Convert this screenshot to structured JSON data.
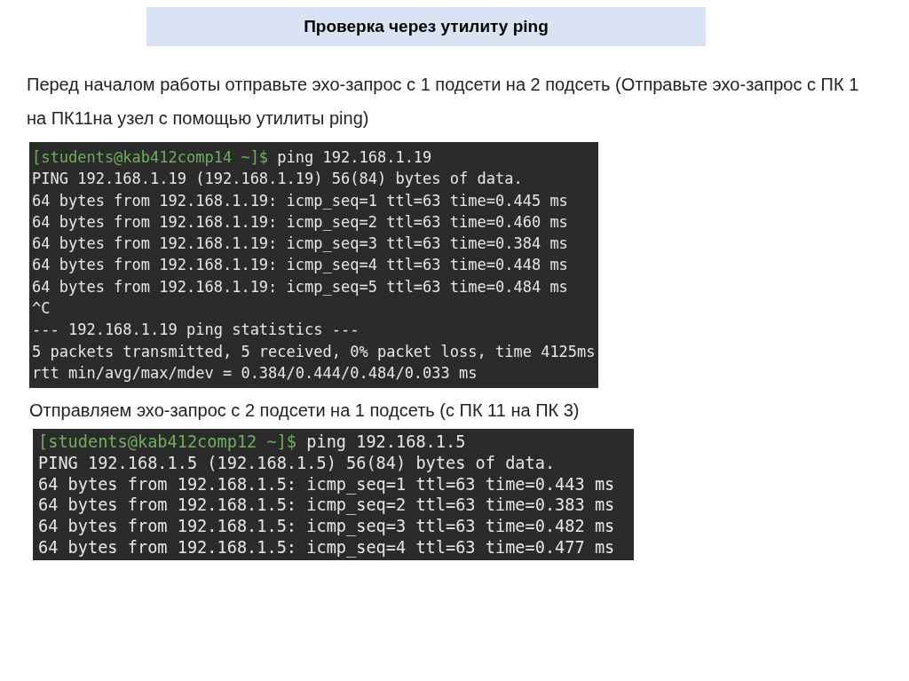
{
  "title": "Проверка через утилиту ping",
  "intro": "Перед началом работы отправьте эхо-запрос с 1 подсети на 2 подсеть (Отправьте эхо-запрос с ПК 1 на ПК11на узел с помощью утилиты ping)",
  "terminal_1": [
    {
      "kind": "prompt",
      "prompt": "[students@kab412comp14 ~]$",
      "command": "ping 192.168.1.19"
    },
    {
      "kind": "output",
      "text": "PING 192.168.1.19 (192.168.1.19) 56(84) bytes of data."
    },
    {
      "kind": "output",
      "text": "64 bytes from 192.168.1.19: icmp_seq=1 ttl=63 time=0.445 ms"
    },
    {
      "kind": "output",
      "text": "64 bytes from 192.168.1.19: icmp_seq=2 ttl=63 time=0.460 ms"
    },
    {
      "kind": "output",
      "text": "64 bytes from 192.168.1.19: icmp_seq=3 ttl=63 time=0.384 ms"
    },
    {
      "kind": "output",
      "text": "64 bytes from 192.168.1.19: icmp_seq=4 ttl=63 time=0.448 ms"
    },
    {
      "kind": "output",
      "text": "64 bytes from 192.168.1.19: icmp_seq=5 ttl=63 time=0.484 ms"
    },
    {
      "kind": "output",
      "text": "^C"
    },
    {
      "kind": "output",
      "text": "--- 192.168.1.19 ping statistics ---"
    },
    {
      "kind": "output",
      "text": "5 packets transmitted, 5 received, 0% packet loss, time 4125ms"
    },
    {
      "kind": "output",
      "text": "rtt min/avg/max/mdev = 0.384/0.444/0.484/0.033 ms"
    }
  ],
  "caption": "Отправляем эхо-запрос с 2 подсети на 1 подсеть (с ПК 11 на ПК 3)",
  "terminal_2": [
    {
      "kind": "prompt",
      "prompt": "[students@kab412comp12 ~]$",
      "command": "ping 192.168.1.5"
    },
    {
      "kind": "output",
      "text": "PING 192.168.1.5 (192.168.1.5) 56(84) bytes of data."
    },
    {
      "kind": "output",
      "text": "64 bytes from 192.168.1.5: icmp_seq=1 ttl=63 time=0.443 ms"
    },
    {
      "kind": "output",
      "text": "64 bytes from 192.168.1.5: icmp_seq=2 ttl=63 time=0.383 ms"
    },
    {
      "kind": "output",
      "text": "64 bytes from 192.168.1.5: icmp_seq=3 ttl=63 time=0.482 ms"
    },
    {
      "kind": "output",
      "text": "64 bytes from 192.168.1.5: icmp_seq=4 ttl=63 time=0.477 ms"
    }
  ]
}
